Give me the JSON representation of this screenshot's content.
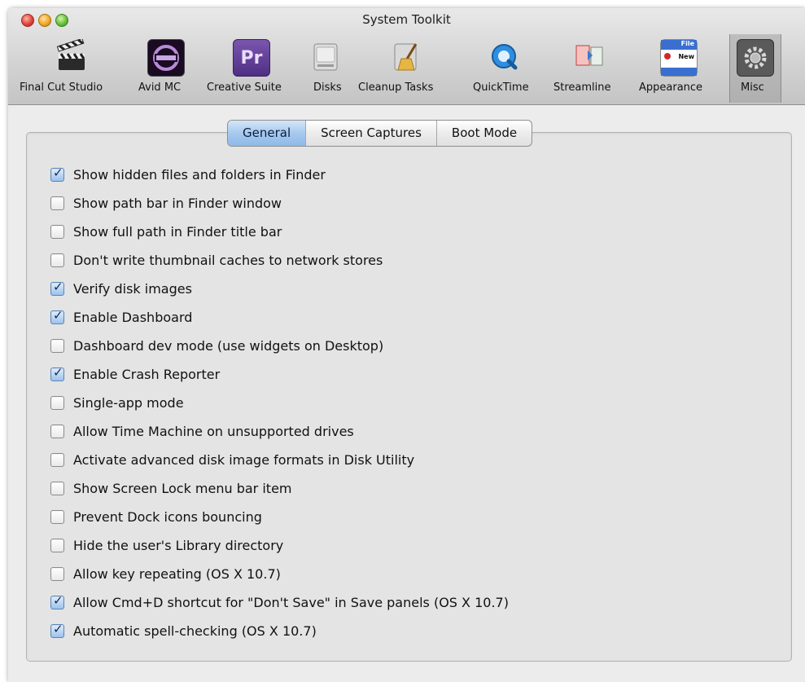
{
  "window": {
    "title": "System Toolkit"
  },
  "toolbar": [
    {
      "label": "Final Cut Studio",
      "icon": "clapperboard-icon",
      "selected": false
    },
    {
      "label": "Avid MC",
      "icon": "avid-media-composer-icon",
      "selected": false
    },
    {
      "label": "Creative Suite",
      "icon": "premiere-pro-icon",
      "selected": false
    },
    {
      "label": "Disks",
      "icon": "hard-disk-icon",
      "selected": false
    },
    {
      "label": "Cleanup Tasks",
      "icon": "broom-icon",
      "selected": false
    },
    {
      "label": "QuickTime",
      "icon": "quicktime-icon",
      "selected": false
    },
    {
      "label": "Streamline",
      "icon": "documents-icon",
      "selected": false
    },
    {
      "label": "Appearance",
      "icon": "menu-window-icon",
      "selected": false
    },
    {
      "label": "Misc",
      "icon": "gear-icon",
      "selected": true
    }
  ],
  "tabs": [
    {
      "label": "General",
      "active": true
    },
    {
      "label": "Screen Captures",
      "active": false
    },
    {
      "label": "Boot Mode",
      "active": false
    }
  ],
  "options": [
    {
      "label": "Show hidden files and folders in Finder",
      "checked": true
    },
    {
      "label": "Show path bar in Finder window",
      "checked": false
    },
    {
      "label": "Show full path in Finder title bar",
      "checked": false
    },
    {
      "label": "Don't write thumbnail caches to network stores",
      "checked": false
    },
    {
      "label": "Verify disk images",
      "checked": true
    },
    {
      "label": "Enable Dashboard",
      "checked": true
    },
    {
      "label": "Dashboard dev mode (use widgets on Desktop)",
      "checked": false
    },
    {
      "label": "Enable Crash Reporter",
      "checked": true
    },
    {
      "label": "Single-app mode",
      "checked": false
    },
    {
      "label": "Allow Time Machine on unsupported drives",
      "checked": false
    },
    {
      "label": "Activate advanced disk image formats in Disk Utility",
      "checked": false
    },
    {
      "label": "Show Screen Lock menu bar item",
      "checked": false
    },
    {
      "label": "Prevent Dock icons bouncing",
      "checked": false
    },
    {
      "label": "Hide the user's Library directory",
      "checked": false
    },
    {
      "label": "Allow key repeating (OS X 10.7)",
      "checked": false
    },
    {
      "label": "Allow Cmd+D shortcut for \"Don't Save\" in Save panels (OS X 10.7)",
      "checked": true
    },
    {
      "label": "Automatic spell-checking (OS X 10.7)",
      "checked": true
    }
  ],
  "icon_text": {
    "premiere": "Pr",
    "appearance_file": "File",
    "appearance_new": "New"
  },
  "colors": {
    "tab_active": "#a7c9ee",
    "checkbox_checked": "#9cc2ee"
  }
}
